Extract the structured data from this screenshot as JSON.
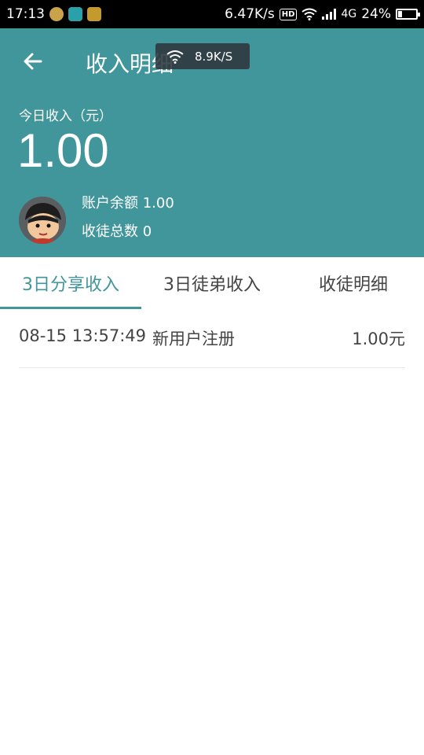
{
  "status_bar": {
    "time": "17:13",
    "net_speed": "6.47K/s",
    "hd": "HD",
    "network_type": "4G",
    "battery": "24%",
    "battery_level": 0.24,
    "app_icon_colors": [
      "#c9a24a",
      "#2aa0a8",
      "#c49a2c"
    ]
  },
  "header": {
    "title": "收入明细",
    "speed_overlay": "8.9K/S",
    "today_label": "今日收入（元）",
    "today_amount": "1.00",
    "balance": "账户余额 1.00",
    "disciples": "收徒总数 0"
  },
  "tabs": [
    {
      "label": "3日分享收入",
      "active": true
    },
    {
      "label": "3日徒弟收入",
      "active": false
    },
    {
      "label": "收徒明细",
      "active": false
    }
  ],
  "records": [
    {
      "datetime": "08-15 13:57:49",
      "desc": "新用户注册",
      "amount": "1.00元"
    }
  ],
  "colors": {
    "accent": "#40969b",
    "status_bar": "#000000",
    "text": "#444444"
  },
  "icons": {
    "back": "back-arrow-icon",
    "wifi": "wifi-icon",
    "signal": "signal-icon",
    "battery": "battery-icon"
  }
}
